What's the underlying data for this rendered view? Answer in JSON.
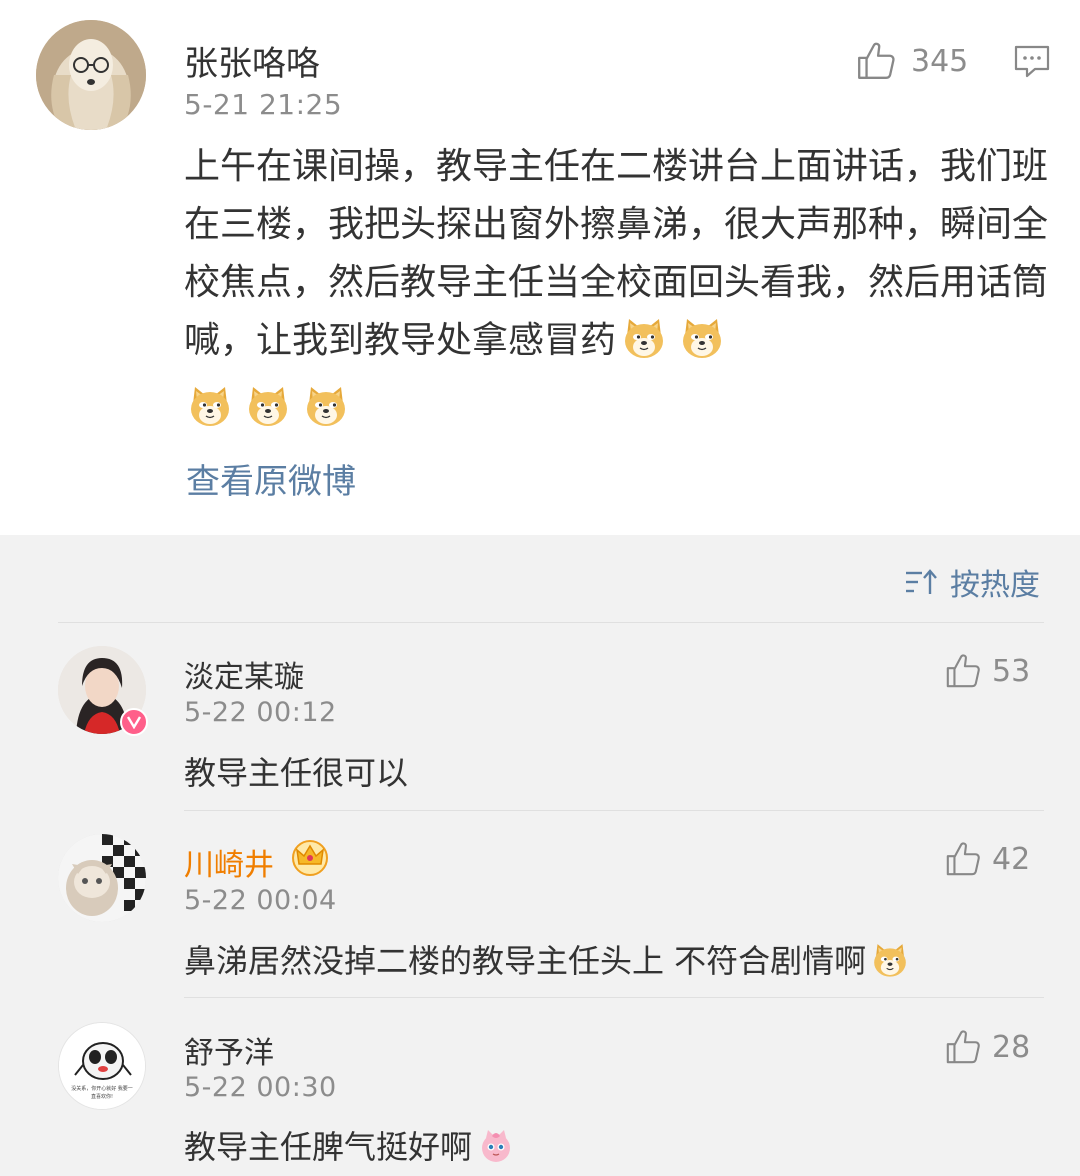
{
  "post": {
    "user_name": "张张咯咯",
    "time": "5-21 21:25",
    "like_count": "345",
    "text": "上午在课间操，教导主任在二楼讲台上面讲话，我们班在三楼，我把头探出窗外擦鼻涕，很大声那种，瞬间全校焦点，然后教导主任当全校面回头看我，然后用话筒喊，让我到教导处拿感冒药",
    "emoji_count": 5,
    "view_original_label": "查看原微博"
  },
  "sort": {
    "label": "按热度"
  },
  "comments": [
    {
      "user_name": "淡定某璇",
      "time": "5-22 00:12",
      "like_count": "53",
      "text": "教导主任很可以"
    },
    {
      "user_name": "川崎井",
      "time": "5-22 00:04",
      "like_count": "42",
      "text": "鼻涕居然没掉二楼的教导主任头上 不符合剧情啊"
    },
    {
      "user_name": "舒予洋",
      "time": "5-22 00:30",
      "like_count": "28",
      "text": "教导主任脾气挺好啊"
    }
  ],
  "avatar_caption": "没关系，你开心就好 我要一直喜欢你!",
  "colors": {
    "link": "#5b7ea3",
    "vip_name": "#f07e00",
    "text": "#333333",
    "meta": "#8c8c8c",
    "background": "#f2f2f2"
  }
}
